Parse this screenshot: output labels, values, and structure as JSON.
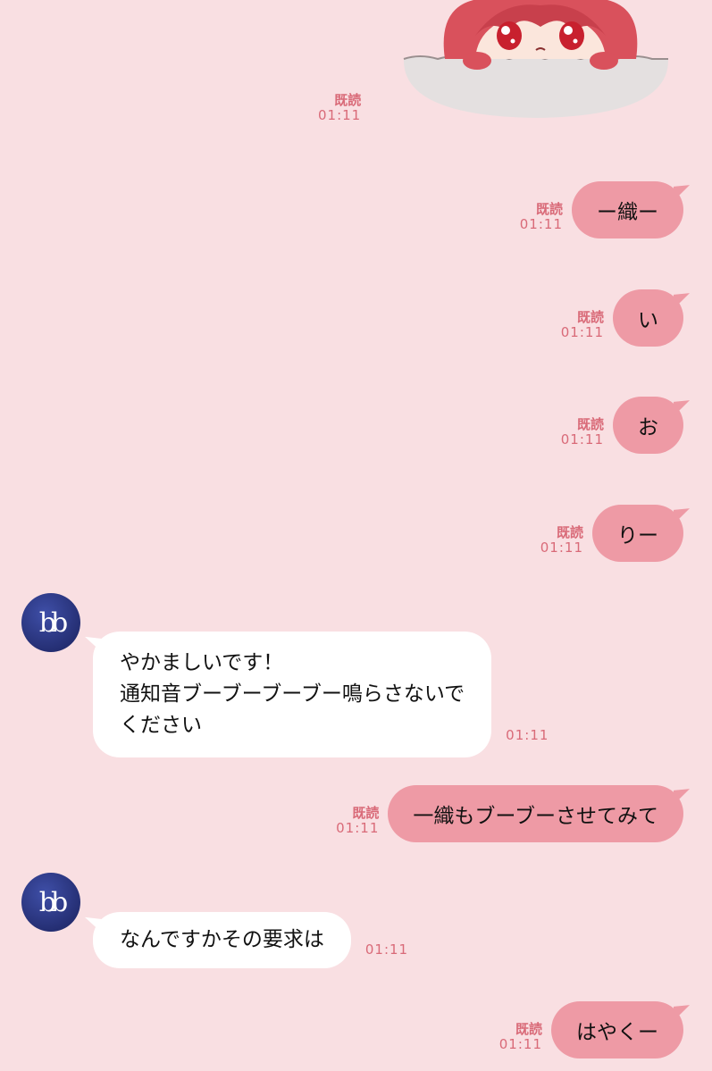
{
  "colors": {
    "background": "#f9dfe2",
    "outgoing_bubble": "#ee9aa5",
    "incoming_bubble": "#ffffff",
    "meta_text": "#d96a78"
  },
  "sticker": {
    "icon": "anime-girl-peeking-sticker",
    "read": "既読",
    "time": "01:11"
  },
  "messages": [
    {
      "direction": "out",
      "text": "ー織ー",
      "read": "既読",
      "time": "01:11"
    },
    {
      "direction": "out",
      "text": "い",
      "read": "既読",
      "time": "01:11"
    },
    {
      "direction": "out",
      "text": "お",
      "read": "既読",
      "time": "01:11"
    },
    {
      "direction": "out",
      "text": "りー",
      "read": "既読",
      "time": "01:11"
    },
    {
      "direction": "in",
      "lines": [
        "やかましいです！",
        "通知音ブーブーブーブー鳴らさないで",
        "ください"
      ],
      "time": "01:11"
    },
    {
      "direction": "out",
      "text": "一織もブーブーさせてみて",
      "read": "既読",
      "time": "01:11"
    },
    {
      "direction": "in",
      "lines": [
        "なんですかその要求は"
      ],
      "time": "01:11"
    },
    {
      "direction": "out",
      "text": "はやくー",
      "read": "既読",
      "time": "01:11"
    }
  ],
  "avatar": {
    "icon": "bb-logo-avatar",
    "glyph": "bb"
  }
}
